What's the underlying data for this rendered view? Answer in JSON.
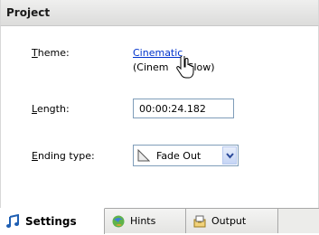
{
  "header": {
    "title": "Project"
  },
  "fields": {
    "theme": {
      "label_underlined": "T",
      "label_rest": "heme:",
      "value_link": "Cinematic",
      "value_desc": "(Cinem",
      "value_desc_tail": ", Slow)"
    },
    "length": {
      "label_underlined": "L",
      "label_rest": "ength:",
      "value": "00:00:24.182"
    },
    "ending": {
      "label_underlined": "E",
      "label_rest": "nding type:",
      "value": "Fade Out",
      "icon": "fade-out-icon"
    }
  },
  "tabs": [
    {
      "label": "Settings",
      "icon": "music-note-icon",
      "active": true
    },
    {
      "label": "Hints",
      "icon": "hints-globe-icon",
      "active": false
    },
    {
      "label": "Output",
      "icon": "output-icon",
      "active": false
    }
  ],
  "colors": {
    "link": "#0033cc",
    "field_border": "#7f9db9"
  }
}
